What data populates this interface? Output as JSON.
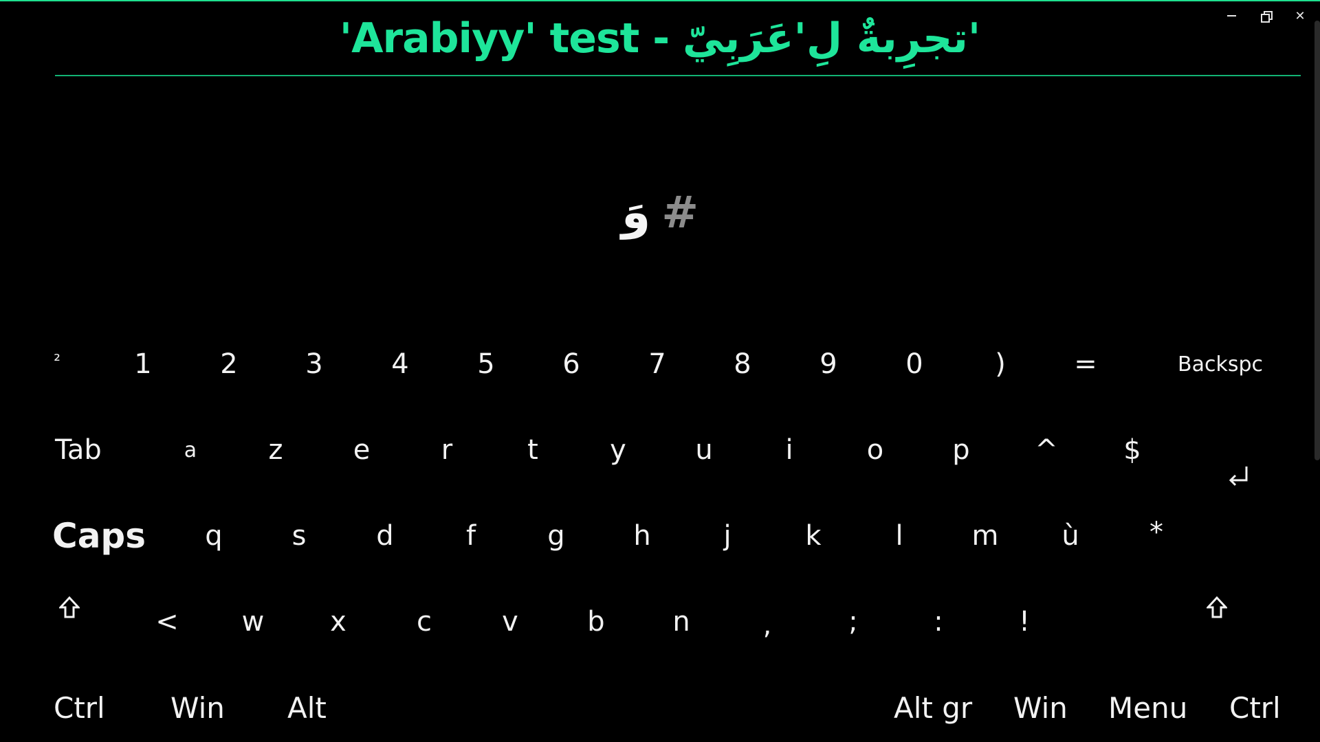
{
  "window": {
    "title": "'Arabiyy' test - تجرِبةٌ لِ'عَرَبِيّ'",
    "accent_color": "#1ee59a",
    "controls": {
      "minimize_icon": "minimize-icon",
      "restore_icon": "restore-icon",
      "close_icon": "close-icon",
      "close_glyph": "✕"
    }
  },
  "prompt": {
    "character": "وَ",
    "hash": "#"
  },
  "keyboard": {
    "row1": [
      "²",
      "1",
      "2",
      "3",
      "4",
      "5",
      "6",
      "7",
      "8",
      "9",
      "0",
      ")",
      "=",
      "Backspc"
    ],
    "row2": [
      "Tab",
      "a",
      "z",
      "e",
      "r",
      "t",
      "y",
      "u",
      "i",
      "o",
      "p",
      "^",
      "$"
    ],
    "row3": [
      "Caps",
      "q",
      "s",
      "d",
      "f",
      "g",
      "h",
      "j",
      "k",
      "l",
      "m",
      "ù",
      "*"
    ],
    "row4": [
      "<",
      "w",
      "x",
      "c",
      "v",
      "b",
      "n",
      ",",
      ";",
      ":",
      "!"
    ],
    "row5": [
      "Ctrl",
      "Win",
      "Alt",
      "Alt gr",
      "Win",
      "Menu",
      "Ctrl"
    ],
    "icons": {
      "enter": "enter-icon",
      "shift_left": "shift-icon",
      "shift_right": "shift-icon"
    }
  }
}
